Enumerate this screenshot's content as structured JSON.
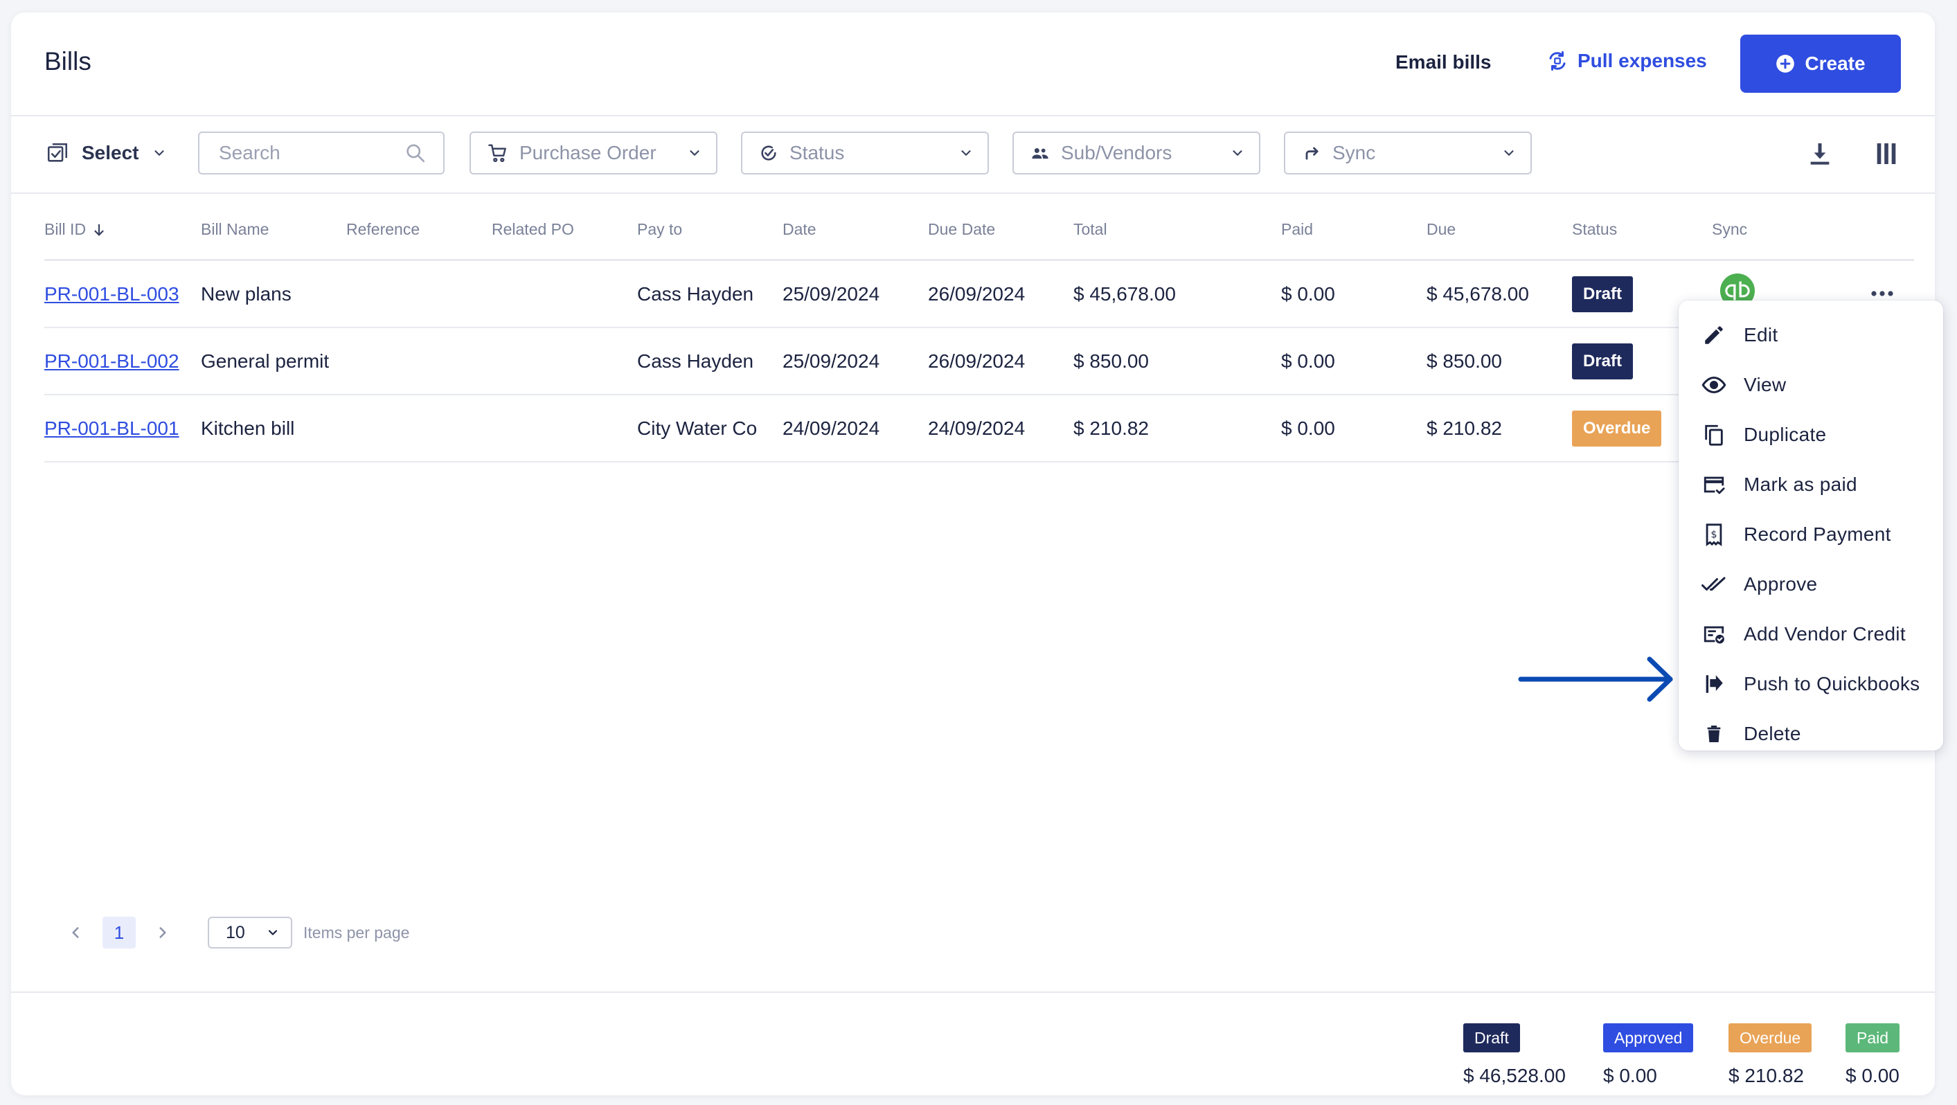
{
  "header": {
    "title": "Bills",
    "email_bills": "Email bills",
    "pull_expenses": "Pull expenses",
    "create": "Create"
  },
  "toolbar": {
    "select_label": "Select",
    "search_placeholder": "Search",
    "filters": {
      "purchase_order": "Purchase Order",
      "status": "Status",
      "sub_vendors": "Sub/Vendors",
      "sync": "Sync"
    }
  },
  "table": {
    "columns": {
      "bill_id": "Bill ID",
      "bill_name": "Bill Name",
      "reference": "Reference",
      "related_po": "Related PO",
      "pay_to": "Pay to",
      "date": "Date",
      "due_date": "Due Date",
      "total": "Total",
      "paid": "Paid",
      "due": "Due",
      "status": "Status",
      "sync": "Sync"
    },
    "rows": [
      {
        "bill_id": "PR-001-BL-003",
        "bill_name": "New plans",
        "reference": "",
        "related_po": "",
        "pay_to": "Cass Hayden",
        "date": "25/09/2024",
        "due_date": "26/09/2024",
        "total": "$ 45,678.00",
        "paid": "$ 0.00",
        "due": "$ 45,678.00",
        "status": "Draft"
      },
      {
        "bill_id": "PR-001-BL-002",
        "bill_name": "General permit",
        "reference": "",
        "related_po": "",
        "pay_to": "Cass Hayden",
        "date": "25/09/2024",
        "due_date": "26/09/2024",
        "total": "$ 850.00",
        "paid": "$ 0.00",
        "due": "$ 850.00",
        "status": "Draft"
      },
      {
        "bill_id": "PR-001-BL-001",
        "bill_name": "Kitchen bill",
        "reference": "",
        "related_po": "",
        "pay_to": "City Water Co",
        "date": "24/09/2024",
        "due_date": "24/09/2024",
        "total": "$ 210.82",
        "paid": "$ 0.00",
        "due": "$ 210.82",
        "status": "Overdue"
      }
    ]
  },
  "context_menu": {
    "items": [
      {
        "label": "Edit",
        "icon": "pencil-icon"
      },
      {
        "label": "View",
        "icon": "eye-icon"
      },
      {
        "label": "Duplicate",
        "icon": "copy-icon"
      },
      {
        "label": "Mark as paid",
        "icon": "card-check-icon"
      },
      {
        "label": "Record Payment",
        "icon": "receipt-dollar-icon"
      },
      {
        "label": "Approve",
        "icon": "double-check-icon"
      },
      {
        "label": "Add Vendor Credit",
        "icon": "credit-badge-icon"
      },
      {
        "label": "Push to Quickbooks",
        "icon": "flag-arrow-icon"
      },
      {
        "label": "Delete",
        "icon": "trash-icon"
      }
    ]
  },
  "pagination": {
    "current_page": "1",
    "per_page": "10",
    "per_page_label": "Items per page"
  },
  "summary": [
    {
      "label": "Draft",
      "value": "$ 46,528.00",
      "color": "#1f2a5c"
    },
    {
      "label": "Approved",
      "value": "$ 0.00",
      "color": "#2f4de0"
    },
    {
      "label": "Overdue",
      "value": "$ 210.82",
      "color": "#e9a356"
    },
    {
      "label": "Paid",
      "value": "$ 0.00",
      "color": "#5cb87a"
    }
  ],
  "colors": {
    "accent": "#2f4de0",
    "text": "#1c2340",
    "draft": "#1f2a5c",
    "overdue": "#e9a356",
    "paid": "#5cb87a",
    "quickbooks": "#4caf50"
  }
}
